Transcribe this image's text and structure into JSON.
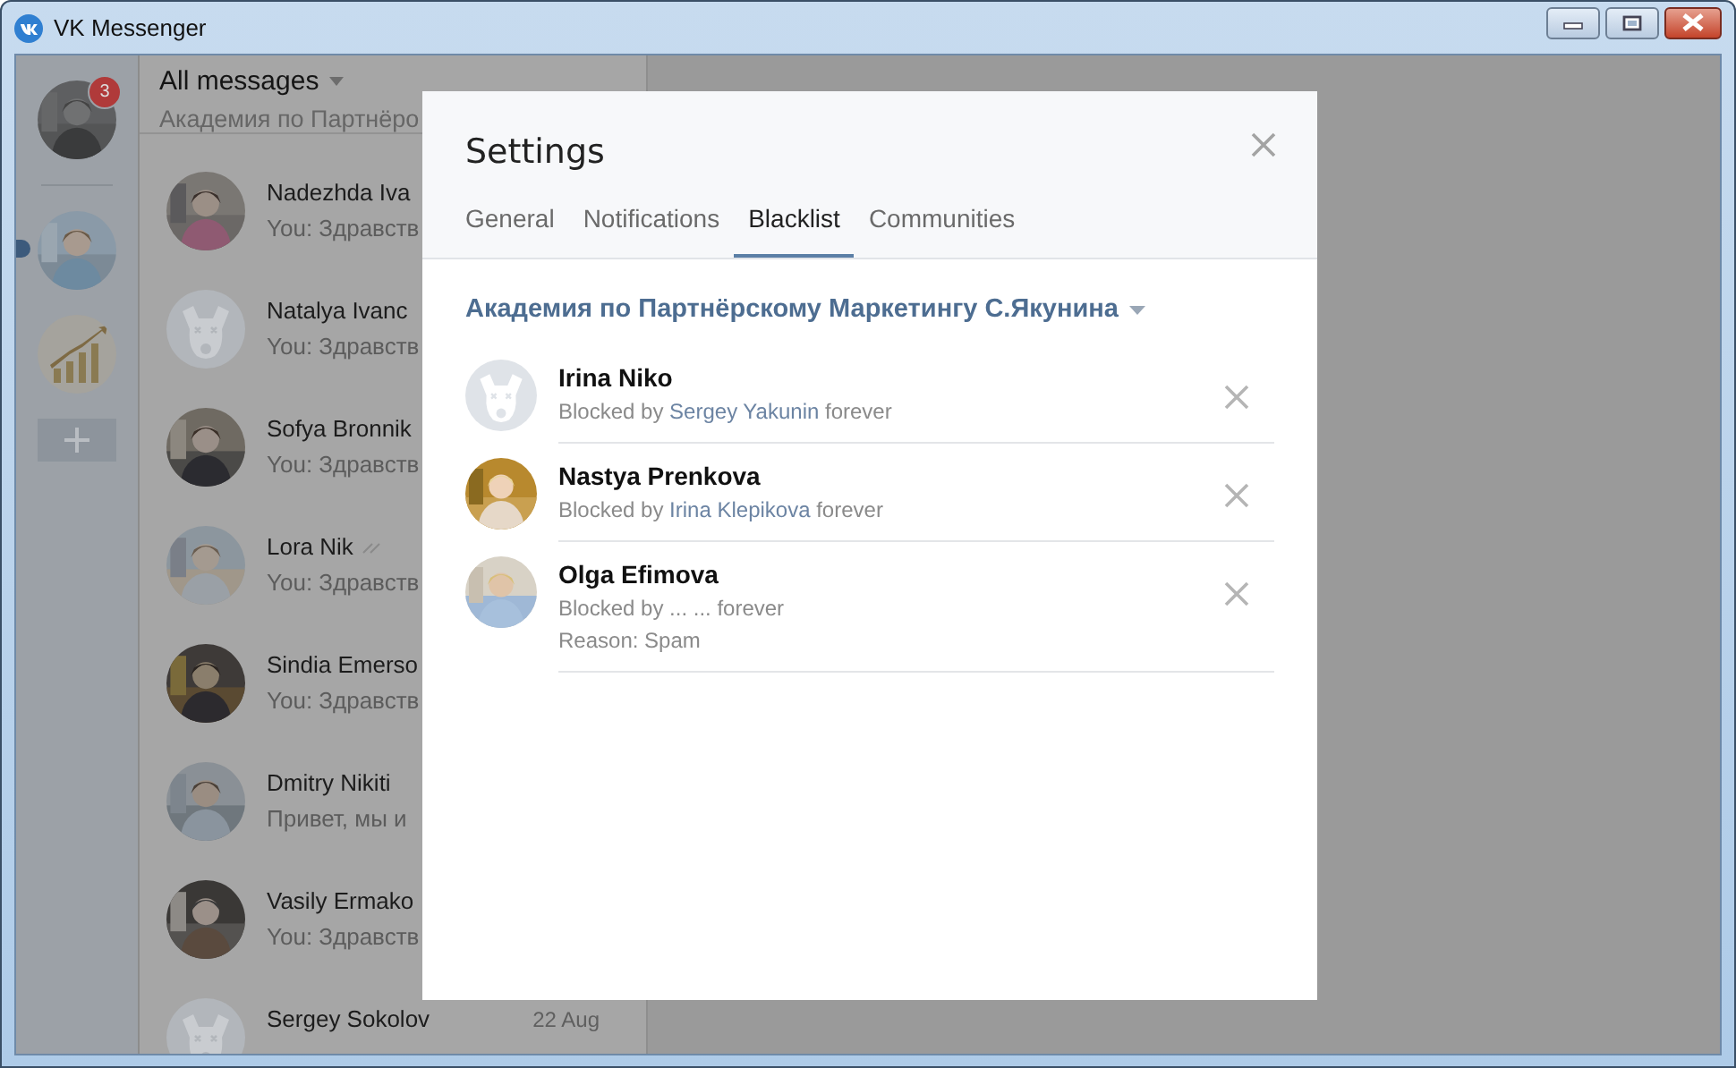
{
  "window": {
    "title": "VK Messenger"
  },
  "rail": {
    "items": [
      {
        "kind": "account",
        "badge": "3",
        "selected": false
      },
      {
        "kind": "account",
        "selected": true
      },
      {
        "kind": "community",
        "selected": false
      },
      {
        "kind": "add"
      }
    ]
  },
  "chat_list": {
    "title": "All messages",
    "subtitle": "Академия по Партнёро",
    "chats": [
      {
        "name": "Nadezhda Iva",
        "preview": "You: Здравств",
        "read_mark": false
      },
      {
        "name": "Natalya Ivanc",
        "preview": "You: Здравств",
        "kind": "default",
        "read_mark": false
      },
      {
        "name": "Sofya Bronnik",
        "preview": "You: Здравств",
        "read_mark": false
      },
      {
        "name": "Lora Nik",
        "preview": "You: Здравств",
        "read_mark": true
      },
      {
        "name": "Sindia Emerso",
        "preview": "You: Здравств",
        "read_mark": false
      },
      {
        "name": "Dmitry Nikiti",
        "preview": "Привет, мы и",
        "read_mark": false
      },
      {
        "name": "Vasily Ermako",
        "preview": "You: Здравств",
        "read_mark": false
      },
      {
        "name": "Sergey Sokolov",
        "date": "22 Aug",
        "kind": "default",
        "read_mark": false
      }
    ]
  },
  "dialog": {
    "title": "Settings",
    "tabs": [
      {
        "label": "General",
        "selected": false
      },
      {
        "label": "Notifications",
        "selected": false
      },
      {
        "label": "Blacklist",
        "selected": true
      },
      {
        "label": "Communities",
        "selected": false
      }
    ],
    "community": "Академия по Партнёрскому Маркетингу С.Якунина",
    "blocked": [
      {
        "name": "Irina Niko",
        "kind": "default",
        "status": "Blocked by",
        "blocker": "Sergey Yakunin",
        "status_end": "forever"
      },
      {
        "name": "Nastya Prenkova",
        "status": "Blocked by",
        "blocker": "Irina Klepikova",
        "status_end": "forever"
      },
      {
        "name": "Olga Efimova",
        "status": "Blocked by ... ... forever",
        "reason": "Reason: Spam"
      }
    ]
  }
}
